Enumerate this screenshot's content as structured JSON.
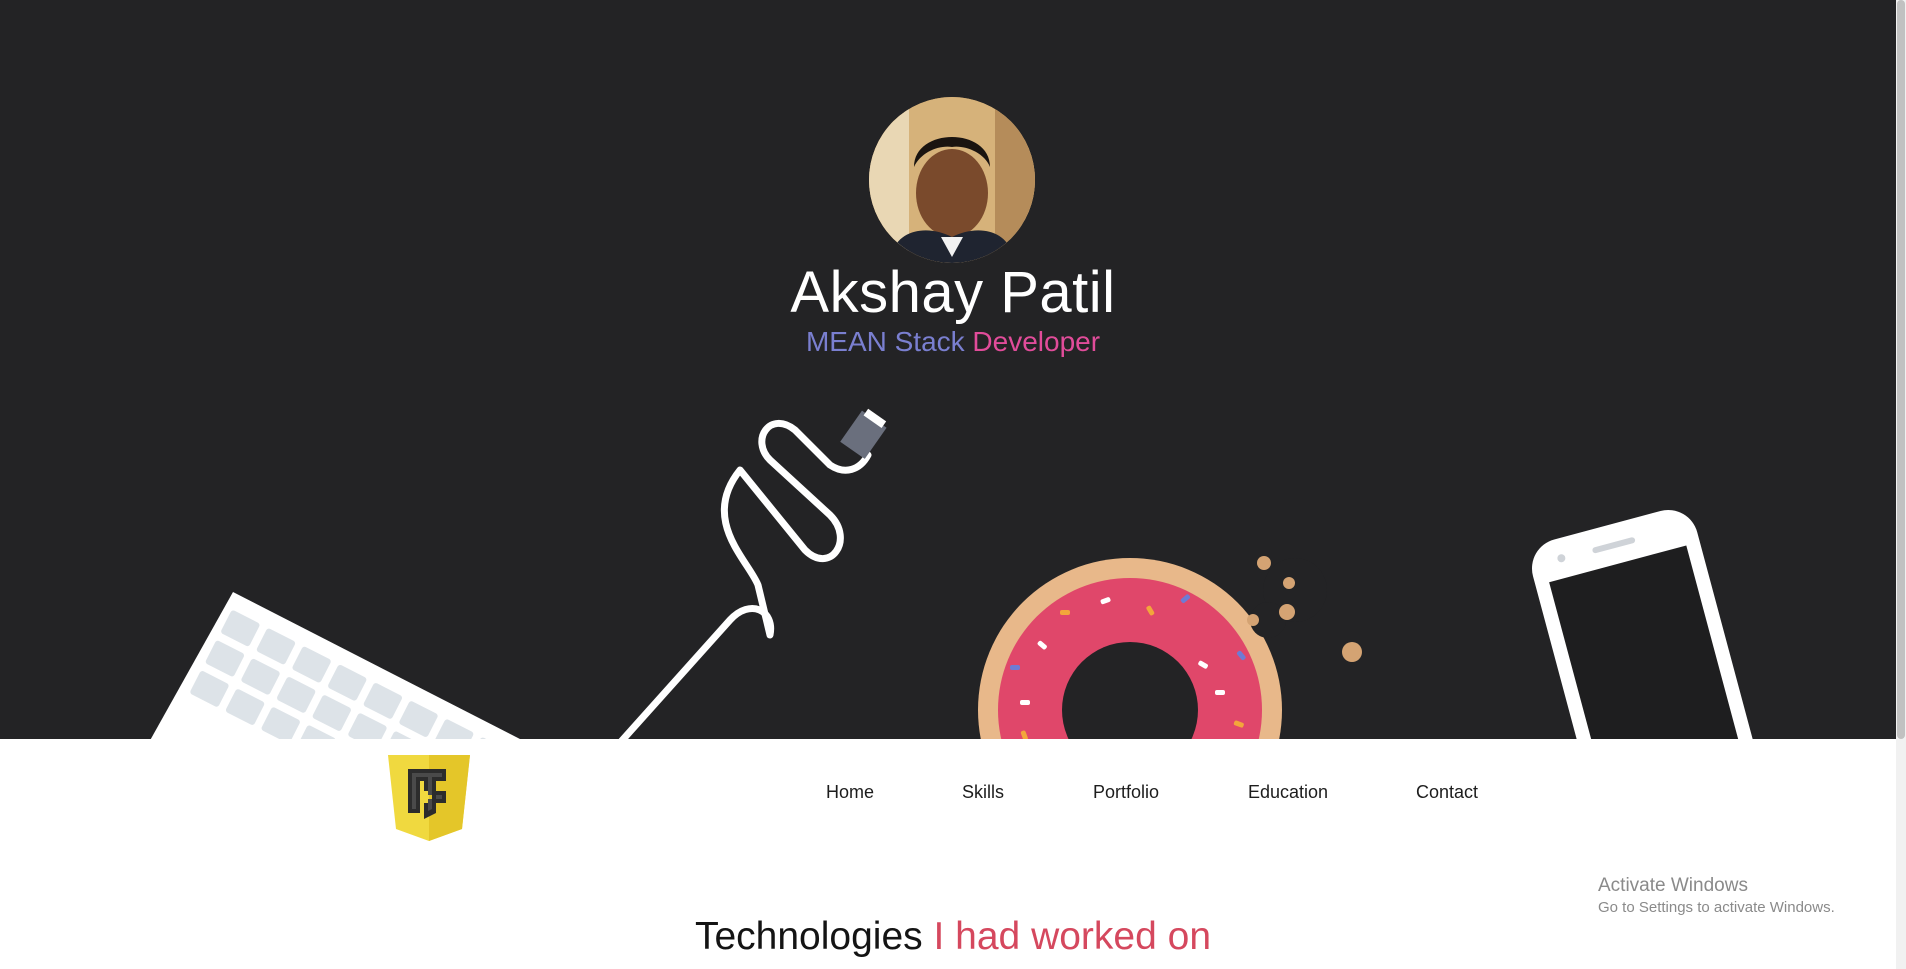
{
  "hero": {
    "name": "Akshay Patil",
    "subtitle_part1": "MEAN Stack",
    "subtitle_part2": "Developer",
    "background_color": "#232325",
    "subtitle_color_1": "#7a7fd0",
    "subtitle_color_2": "#e14c9a",
    "illustrations": [
      "keyboard-illustration",
      "usb-cable-illustration",
      "donut-illustration",
      "smartphone-illustration"
    ]
  },
  "nav": {
    "logo_icon": "javascript-shield-logo",
    "items": [
      "Home",
      "Skills",
      "Portfolio",
      "Education",
      "Contact"
    ]
  },
  "section": {
    "title_part1": "Technologies",
    "title_part2": "I had worked on",
    "accent_color": "#d5485e"
  },
  "watermark": {
    "title": "Activate Windows",
    "subtitle": "Go to Settings to activate Windows."
  }
}
